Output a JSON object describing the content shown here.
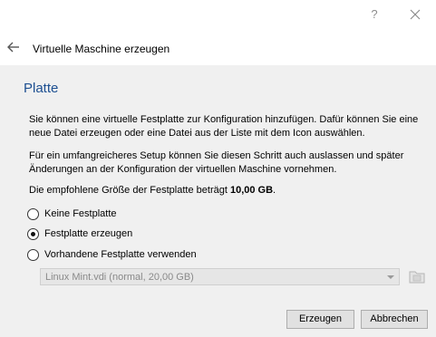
{
  "window": {
    "help_label": "?"
  },
  "header": {
    "title": "Virtuelle Maschine erzeugen"
  },
  "page": {
    "heading": "Platte",
    "paragraph1": "Sie können eine virtuelle Festplatte zur Konfiguration hinzufügen. Dafür können Sie eine neue Datei erzeugen oder eine Datei aus der Liste mit dem Icon auswählen.",
    "paragraph2": "Für ein umfangreicheres Setup können Sie diesen Schritt auch auslassen und später Änderungen an der Konfiguration der virtuellen Maschine vornehmen.",
    "size_prefix": "Die empfohlene Größe der Festplatte beträgt ",
    "size_value": "10,00 GB",
    "size_suffix": "."
  },
  "options": [
    {
      "label": "Keine Festplatte",
      "checked": false
    },
    {
      "label": "Festplatte erzeugen",
      "checked": true
    },
    {
      "label": "Vorhandene Festplatte verwenden",
      "checked": false
    }
  ],
  "disk_select": {
    "value": "Linux Mint.vdi (normal, 20,00 GB)",
    "enabled": false
  },
  "buttons": {
    "create": "Erzeugen",
    "cancel": "Abbrechen"
  },
  "icons": {
    "help": "question-mark-icon",
    "close": "close-icon",
    "back": "arrow-left-icon",
    "folder": "folder-icon"
  },
  "colors": {
    "heading": "#1d4f91",
    "content_bg": "#f0f0f0"
  }
}
